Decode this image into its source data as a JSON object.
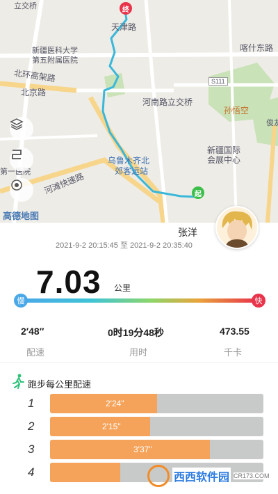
{
  "map": {
    "labels": {
      "tianjin_road": "天津路",
      "hospital": "新疆医科大学",
      "hospital2": "第五附属医院",
      "kashi_east_road": "喀什东路",
      "beijing_road": "北京路",
      "beijing_road_overpass": "北环高架路",
      "s111": "S111",
      "henan_road_overpass": "河南路立交桥",
      "sunwukong": "孙悟空",
      "expo": "新疆国际",
      "expo2": "会展中心",
      "station": "乌鲁木齐北",
      "station2": "郊客运站",
      "hexi_expressway": "河滩快速路",
      "first_hospital": "第一医院",
      "top_left_bridge": "立交桥",
      "amap_logo": "高德地图",
      "right_edge": "俊友"
    },
    "start_marker": "起",
    "end_marker": "终",
    "route_color": "#3ab7d9"
  },
  "user": {
    "name": "张洋",
    "time_range": "2021-9-2 20:15:45 至 2021-9-2 20:35:40"
  },
  "distance": {
    "value": "7.03",
    "unit": "公里"
  },
  "pace_scale": {
    "slow_label": "慢",
    "fast_label": "快",
    "slow_color": "#4aa8e8",
    "fast_color": "#e8334b"
  },
  "stats": {
    "pace": {
      "value": "2′48″",
      "label": "配速"
    },
    "duration": {
      "value": "0时19分48秒",
      "label": "用时"
    },
    "calories": {
      "value": "473.55",
      "label": "千卡"
    }
  },
  "pace_section": {
    "title": "跑步每公里配速",
    "rows": [
      {
        "km": "1",
        "value": "2'24\"",
        "fill_fraction": 0.5
      },
      {
        "km": "2",
        "value": "2'15\"",
        "fill_fraction": 0.47
      },
      {
        "km": "3",
        "value": "3'37\"",
        "fill_fraction": 0.75
      },
      {
        "km": "4",
        "value": "",
        "fill_fraction": 0.33
      }
    ]
  },
  "watermark": {
    "brand": "西西软件园",
    "url": "CR173.COM"
  }
}
